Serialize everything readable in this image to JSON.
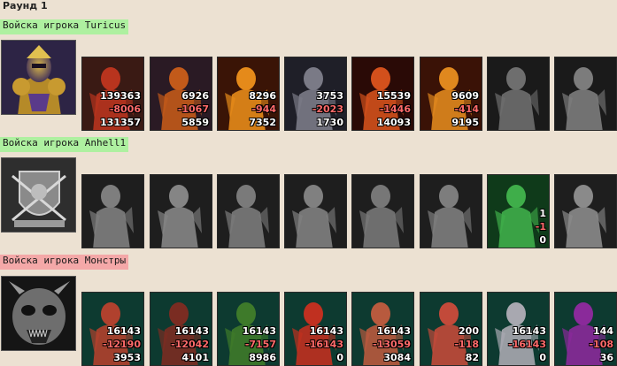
{
  "round_title": "Раунд 1",
  "colors": {
    "page_bg": "#ece1d2",
    "player_header_bg": "#aef0a0",
    "monster_header_bg": "#f4a8a8",
    "loss_text": "#ff6a6a"
  },
  "armies": [
    {
      "header": "Войска игрока Turicus",
      "hero_icon": "golden-armored-hero-portrait",
      "units": [
        {
          "icon": "red-dragon-icon",
          "initial": "139363",
          "loss": "-8006",
          "remaining": "131357"
        },
        {
          "icon": "fire-lich-icon",
          "initial": "6926",
          "loss": "-1067",
          "remaining": "5859"
        },
        {
          "icon": "fire-elemental-icon",
          "initial": "8296",
          "loss": "-944",
          "remaining": "7352"
        },
        {
          "icon": "bone-dragon-icon",
          "initial": "3753",
          "loss": "-2023",
          "remaining": "1730"
        },
        {
          "icon": "lava-golem-icon",
          "initial": "15539",
          "loss": "-1446",
          "remaining": "14093"
        },
        {
          "icon": "fire-demon-icon",
          "initial": "9609",
          "loss": "-414",
          "remaining": "9195"
        },
        {
          "icon": "dark-knight-icon",
          "initial": "",
          "loss": "",
          "remaining": ""
        },
        {
          "icon": "reaper-icon",
          "initial": "",
          "loss": "",
          "remaining": ""
        }
      ]
    },
    {
      "header": "Войска игрока Anhell1",
      "hero_icon": "crest-with-crossbow-portrait",
      "units": [
        {
          "icon": "dwarf-warrior-icon",
          "initial": "",
          "loss": "",
          "remaining": ""
        },
        {
          "icon": "swordsman-icon",
          "initial": "",
          "loss": "",
          "remaining": ""
        },
        {
          "icon": "spearman-icon",
          "initial": "",
          "loss": "",
          "remaining": ""
        },
        {
          "icon": "griffin-icon",
          "initial": "",
          "loss": "",
          "remaining": ""
        },
        {
          "icon": "archer-icon",
          "initial": "",
          "loss": "",
          "remaining": ""
        },
        {
          "icon": "monk-icon",
          "initial": "",
          "loss": "",
          "remaining": ""
        },
        {
          "icon": "green-mage-icon",
          "initial": "1",
          "loss": "-1",
          "remaining": "0"
        },
        {
          "icon": "druid-icon",
          "initial": "",
          "loss": "",
          "remaining": ""
        }
      ]
    },
    {
      "header": "Войска игрока Монстры",
      "hero_icon": "demon-skull-portrait",
      "units": [
        {
          "icon": "serpent-icon",
          "initial": "16143",
          "loss": "-12190",
          "remaining": "3953"
        },
        {
          "icon": "armored-beast-icon",
          "initial": "16143",
          "loss": "-12042",
          "remaining": "4101"
        },
        {
          "icon": "orc-warlord-icon",
          "initial": "16143",
          "loss": "-7157",
          "remaining": "8986"
        },
        {
          "icon": "red-gargoyle-icon",
          "initial": "16143",
          "loss": "-16143",
          "remaining": "0"
        },
        {
          "icon": "spiked-beast-icon",
          "initial": "16143",
          "loss": "-13059",
          "remaining": "3084"
        },
        {
          "icon": "red-wyrm-icon",
          "initial": "200",
          "loss": "-118",
          "remaining": "82"
        },
        {
          "icon": "stone-totem-icon",
          "initial": "16143",
          "loss": "-16143",
          "remaining": "0"
        },
        {
          "icon": "dark-sorcerer-icon",
          "initial": "144",
          "loss": "-108",
          "remaining": "36"
        }
      ]
    }
  ]
}
